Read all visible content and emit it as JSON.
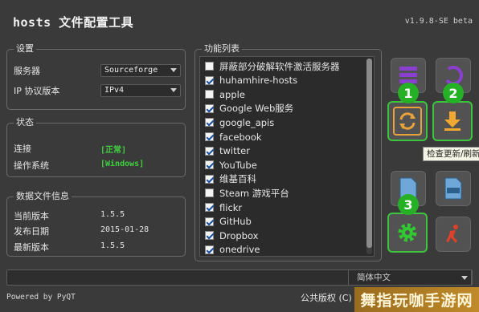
{
  "window": {
    "title": "hosts 文件配置工具",
    "version": "v1.9.8-SE beta"
  },
  "settings": {
    "group_title": "设置",
    "server_label": "服务器",
    "server_value": "Sourceforge",
    "ip_label": "IP 协议版本",
    "ip_value": "IPv4"
  },
  "status": {
    "group_title": "状态",
    "connection_label": "连接",
    "connection_value": "[正常]",
    "os_label": "操作系统",
    "os_value": "[Windows]"
  },
  "datafile": {
    "group_title": "数据文件信息",
    "current_label": "当前版本",
    "current_value": "1.5.5",
    "release_label": "发布日期",
    "release_value": "2015-01-28",
    "latest_label": "最新版本",
    "latest_value": "1.5.5"
  },
  "functions": {
    "group_title": "功能列表",
    "items": [
      {
        "label": "屏蔽部分破解软件激活服务器",
        "checked": false
      },
      {
        "label": "huhamhire-hosts",
        "checked": true
      },
      {
        "label": "apple",
        "checked": false
      },
      {
        "label": "Google Web服务",
        "checked": true
      },
      {
        "label": "google_apis",
        "checked": true
      },
      {
        "label": "facebook",
        "checked": true
      },
      {
        "label": "twitter",
        "checked": true
      },
      {
        "label": "YouTube",
        "checked": true
      },
      {
        "label": "维基百科",
        "checked": true
      },
      {
        "label": "Steam 游戏平台",
        "checked": false
      },
      {
        "label": "flickr",
        "checked": true
      },
      {
        "label": "GitHub",
        "checked": true
      },
      {
        "label": "Dropbox",
        "checked": true
      },
      {
        "label": "onedrive",
        "checked": true
      }
    ]
  },
  "tools": {
    "badges": [
      "1",
      "2",
      "3"
    ],
    "tooltip": "检查更新/刷新"
  },
  "bottom": {
    "language": "简体中文",
    "powered": "Powered by PyQT",
    "copyright": "公共版权 (C)"
  },
  "watermark": "舞指玩咖手游网",
  "colors": {
    "accent_green": "#3cc43c",
    "status_green": "#3fcf3f",
    "refresh_orange": "#e8a23a",
    "download_orange": "#f0a830",
    "gear_green": "#32c832",
    "run_red": "#e0402a"
  }
}
